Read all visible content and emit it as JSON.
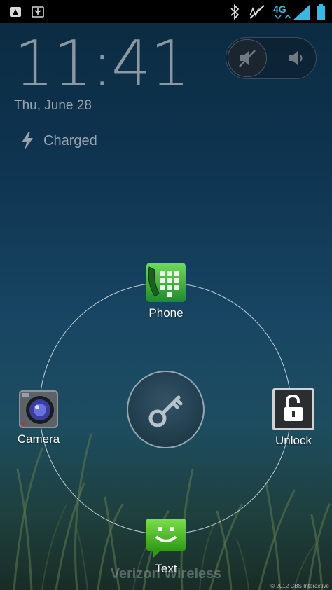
{
  "status_bar": {
    "left_icons": [
      "usb-debug-icon",
      "usb-icon"
    ],
    "right_icons": [
      "bluetooth-icon",
      "vibrate-off-icon",
      "4g-lte-signal-icon",
      "battery-icon"
    ],
    "network_label": "4G"
  },
  "lockscreen": {
    "time": "11:41",
    "date": "Thu, June 28",
    "charge_status": "Charged",
    "charge_icon": "lightning-bolt-icon",
    "sound_toggle": {
      "mute_icon": "speaker-muted-icon",
      "sound_icon": "speaker-icon",
      "selected": "mute"
    },
    "unlock_handle_icon": "key-icon",
    "targets": {
      "phone": {
        "label": "Phone",
        "icon": "phone-app-icon"
      },
      "camera": {
        "label": "Camera",
        "icon": "camera-app-icon"
      },
      "unlock": {
        "label": "Unlock",
        "icon": "padlock-open-icon"
      },
      "text": {
        "label": "Text",
        "icon": "messaging-app-icon"
      }
    },
    "carrier": "Verizon Wireless"
  },
  "watermark": "© 2012 CBS Interactive",
  "colors": {
    "phone_green": "#2fa83a",
    "text_green": "#4cc31c",
    "ring": "#dce6ec",
    "clock_text": "#9aa4ac"
  }
}
